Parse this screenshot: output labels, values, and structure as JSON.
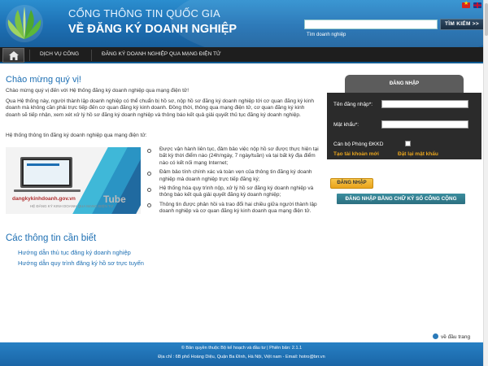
{
  "header": {
    "title_line1": "CỔNG THÔNG TIN QUỐC GIA",
    "title_line2": "VỀ ĐĂNG KÝ DOANH NGHIỆP",
    "search_button": "TÌM KIẾM >>",
    "search_hint": "Tìm doanh nghiệp",
    "search_value": ""
  },
  "nav": {
    "items": [
      {
        "label": "DỊCH VỤ CÔNG"
      },
      {
        "label": "ĐĂNG KÝ DOANH NGHIỆP QUA MẠNG ĐIỆN TỬ"
      }
    ]
  },
  "main": {
    "welcome_title": "Chào mừng quý vị!",
    "paragraphs": [
      "Chào mừng quý vị đến với Hệ thống đăng ký doanh nghiệp qua mạng điện tử!",
      "Qua Hệ thống này, người thành lập doanh nghiệp có thể chuẩn bị hồ sơ, nộp hồ sơ đăng ký doanh nghiệp tới cơ quan đăng ký kinh doanh mà không cần phải trực tiếp đến cơ quan đăng ký kinh doanh. Đồng thời, thông qua mạng điện tử, cơ quan đăng ký kinh doanh sẽ tiếp nhận, xem xét xử lý hồ sơ đăng ký doanh nghiệp và thông báo kết quả giải quyết thủ tục đăng ký doanh nghiệp.",
      "Hệ thống thông tin đăng ký doanh nghiệp qua mạng điện tử:"
    ],
    "video_label": "dangkykinhdoanh.gov.vn",
    "video_sub": "HỆ ĐĂNG KÝ KINH DOANH QUA MẠNG ĐIỆN TỬ",
    "video_brand": "Tube",
    "bullets": [
      "Được vận hành liên tục, đảm bảo việc nộp hồ sơ được thực hiện tại bất kỳ thời điểm nào (24h/ngày, 7 ngày/tuần) và tại bất kỳ địa điểm nào có kết nối mạng Internet;",
      "Đảm bảo tính chính xác và toàn vẹn của thông tin đăng ký doanh nghiệp mà doanh nghiệp trực tiếp đăng ký;",
      "Hệ thống hóa quy trình nộp, xử lý hồ sơ đăng ký doanh nghiệp và thông báo kết quả giải quyết đăng ký doanh nghiệp;",
      "Thông tin được phản hồi và trao đổi hai chiều giữa người thành lập doanh nghiệp và cơ quan đăng ký kinh doanh qua mạng điện tử."
    ],
    "info_title": "Các thông tin cần biết",
    "links": [
      {
        "label": "Hướng dẫn thủ tục đăng ký doanh nghiệp"
      },
      {
        "label": "Hướng dẫn quy trình đăng ký hồ sơ trực tuyến"
      }
    ]
  },
  "login": {
    "tab_title": "ĐĂNG NHẬP",
    "username_label": "Tên đăng nhập*:",
    "password_label": "Mật khẩu*:",
    "username_value": "",
    "password_value": "",
    "officer_label": "Cán bộ Phòng ĐKKD",
    "officer_checked": false,
    "register_link": "Tạo tài khoản mới",
    "forgot_link": "Đặt lại mật khẩu",
    "login_button": "ĐĂNG NHẬP",
    "signature_button": "ĐĂNG NHẬP BẰNG CHỮ KÝ SỐ CÔNG CỘNG"
  },
  "footer": {
    "back_to_top": "về đầu trang",
    "line1": "© Bản quyền thuộc Bộ kế hoạch và đầu tư | Phiên bản: 2.1.1",
    "line2": "Địa chỉ : 6B phố Hoàng Diệu, Quận Ba Đình, Hà Nội, Việt nam - Email: hotro@brr.vn"
  },
  "colors": {
    "header_blue": "#1d6fb3",
    "link_blue": "#1d6fb3",
    "login_dark": "#2b2b2b",
    "accent_orange": "#e9a51d",
    "signature_teal": "#2c6f80"
  },
  "icons": [
    "logo-leaf-icon",
    "flag-vietnam-icon",
    "flag-uk-icon",
    "home-icon",
    "back-to-top-icon"
  ]
}
